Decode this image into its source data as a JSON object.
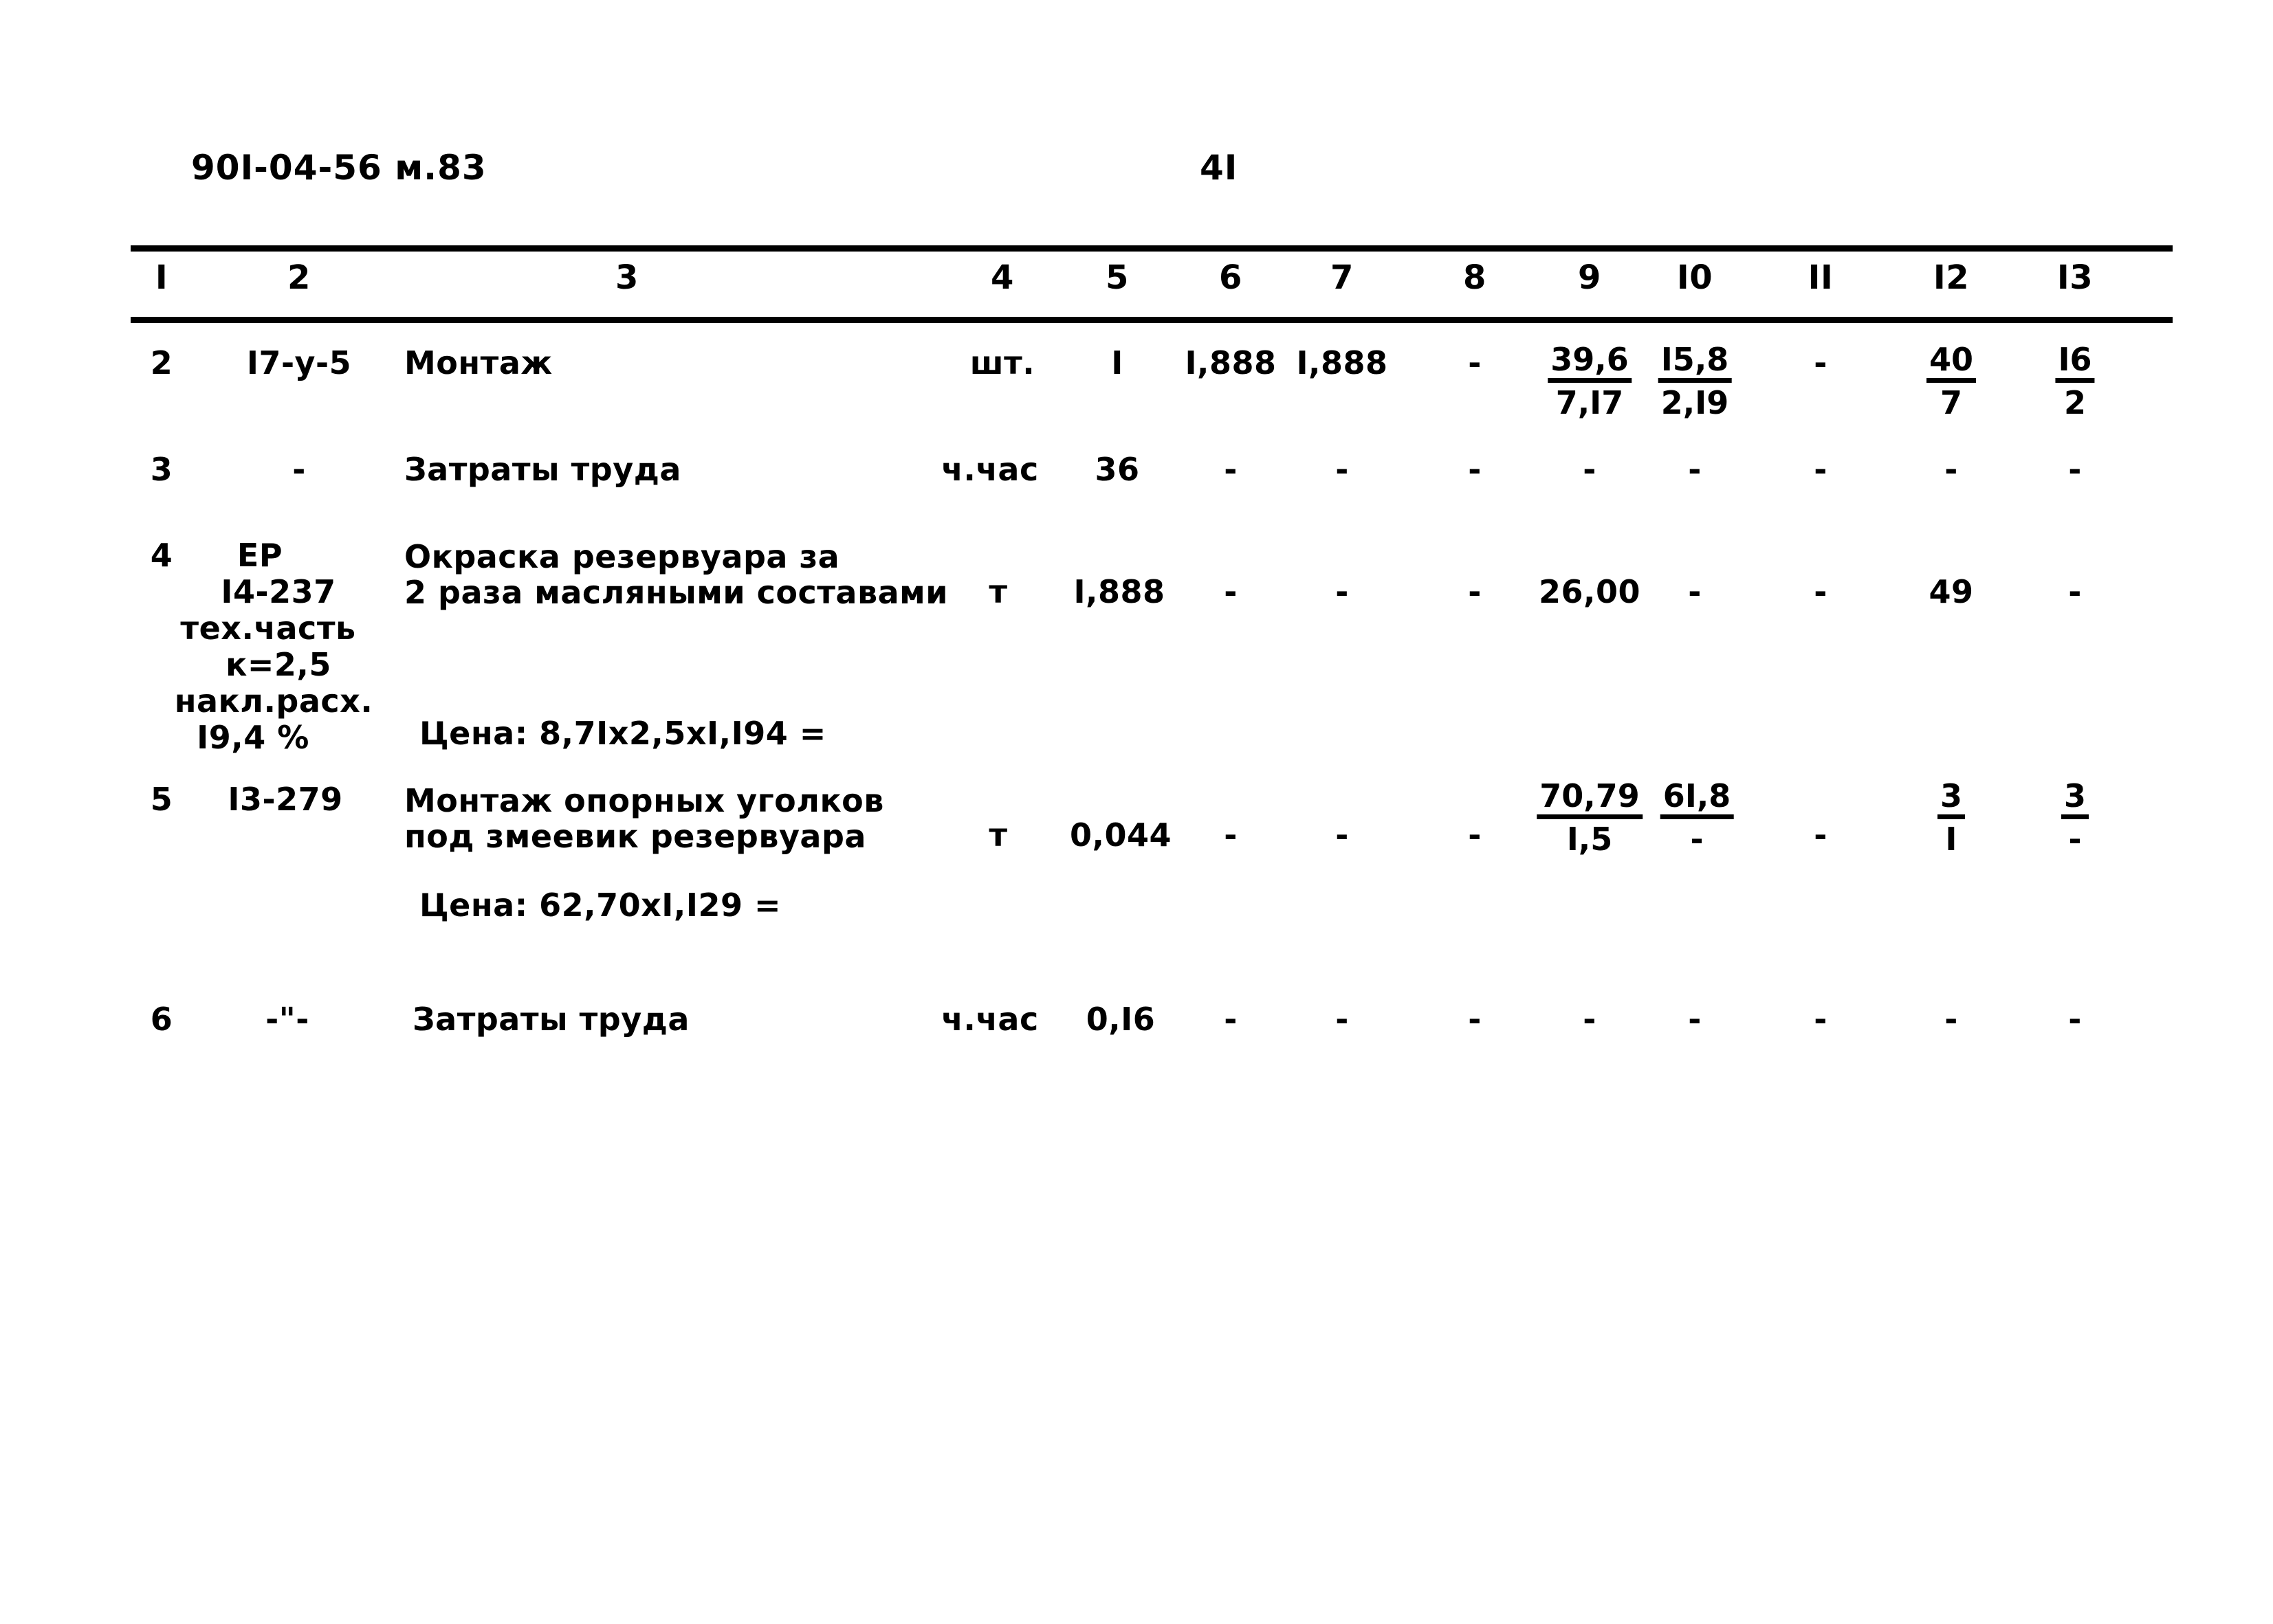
{
  "document": {
    "code": "90I-04-56 м.83",
    "page_number": "4I"
  },
  "table": {
    "column_headers": [
      "I",
      "2",
      "3",
      "4",
      "5",
      "6",
      "7",
      "8",
      "9",
      "I0",
      "II",
      "I2",
      "I3"
    ],
    "rows": [
      {
        "num": "2",
        "code": "I7-у-5",
        "description": "Монтаж",
        "unit": "шт.",
        "c5": "I",
        "c6": "I,888",
        "c7": "I,888",
        "c8": "-",
        "c9_num": "39,6",
        "c9_den": "7,I7",
        "c10_num": "I5,8",
        "c10_den": "2,I9",
        "c11": "-",
        "c12_num": "40",
        "c12_den": "7",
        "c13_num": "I6",
        "c13_den": "2"
      },
      {
        "num": "3",
        "code": "-",
        "description": "Затраты труда",
        "unit": "ч.час",
        "c5": "36",
        "c6": "-",
        "c7": "-",
        "c8": "-",
        "c9": "-",
        "c10": "-",
        "c11": "-",
        "c12": "-",
        "c13": "-"
      },
      {
        "num": "4",
        "code_line1": "ЕР",
        "code_line2": "I4-237",
        "code_line3": "тех.часть",
        "code_line4": "к=2,5",
        "code_line5": "накл.расх.",
        "code_line6": "I9,4 %",
        "description": "Окраска резервуара за\n2 раза масляными составами",
        "price_note": "Цена: 8,7Iх2,5хI,I94 =",
        "unit": "т",
        "c5": "I,888",
        "c6": "-",
        "c7": "-",
        "c8": "-",
        "c9": "26,00",
        "c10": "-",
        "c11": "-",
        "c12": "49",
        "c13": "-"
      },
      {
        "num": "5",
        "code": "I3-279",
        "description": "Монтаж опорных уголков\nпод змеевик резервуара",
        "price_note": "Цена: 62,70хI,I29 =",
        "unit": "т",
        "c5": "0,044",
        "c6": "-",
        "c7": "-",
        "c8": "-",
        "c9_num": "70,79",
        "c9_den": "I,5",
        "c10_num": "6I,8",
        "c10_den": "-",
        "c11": "-",
        "c12_num": "3",
        "c12_den": "I",
        "c13_num": "3",
        "c13_den": "-"
      },
      {
        "num": "6",
        "code": "-\"-",
        "description": "Затраты труда",
        "unit": "ч.час",
        "c5": "0,I6",
        "c6": "-",
        "c7": "-",
        "c8": "-",
        "c9": "-",
        "c10": "-",
        "c11": "-",
        "c12": "-",
        "c13": "-"
      }
    ]
  }
}
